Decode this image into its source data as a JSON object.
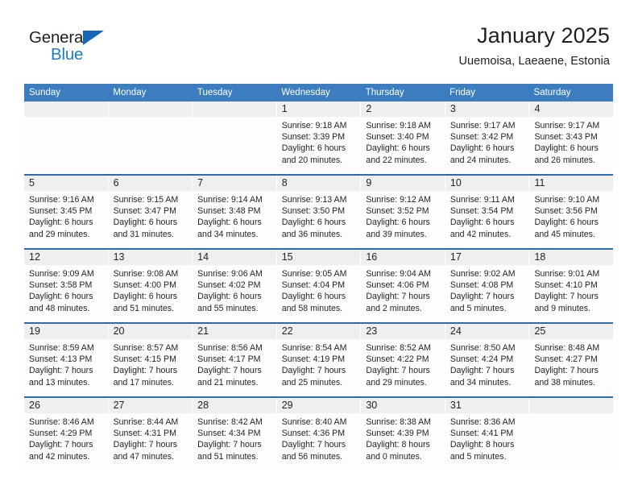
{
  "brand": {
    "logo_text_top": "General",
    "logo_text_bottom": "Blue",
    "logo_triangle_icon": "triangle-icon",
    "color_dark": "#231f20",
    "color_blue": "#1d7ec4"
  },
  "header": {
    "title": "January 2025",
    "subtitle": "Uuemoisa, Laeaene, Estonia"
  },
  "theme": {
    "header_row_bg": "#3b7dbf",
    "week_divider": "#2b6caf",
    "daynum_bg": "#efefef",
    "cell_bg": "#fdfdfd",
    "text": "#231f20"
  },
  "calendar": {
    "day_headers": [
      "Sunday",
      "Monday",
      "Tuesday",
      "Wednesday",
      "Thursday",
      "Friday",
      "Saturday"
    ],
    "weeks": [
      [
        {
          "day": "",
          "lines": []
        },
        {
          "day": "",
          "lines": []
        },
        {
          "day": "",
          "lines": []
        },
        {
          "day": "1",
          "lines": [
            "Sunrise: 9:18 AM",
            "Sunset: 3:39 PM",
            "Daylight: 6 hours",
            "and 20 minutes."
          ]
        },
        {
          "day": "2",
          "lines": [
            "Sunrise: 9:18 AM",
            "Sunset: 3:40 PM",
            "Daylight: 6 hours",
            "and 22 minutes."
          ]
        },
        {
          "day": "3",
          "lines": [
            "Sunrise: 9:17 AM",
            "Sunset: 3:42 PM",
            "Daylight: 6 hours",
            "and 24 minutes."
          ]
        },
        {
          "day": "4",
          "lines": [
            "Sunrise: 9:17 AM",
            "Sunset: 3:43 PM",
            "Daylight: 6 hours",
            "and 26 minutes."
          ]
        }
      ],
      [
        {
          "day": "5",
          "lines": [
            "Sunrise: 9:16 AM",
            "Sunset: 3:45 PM",
            "Daylight: 6 hours",
            "and 29 minutes."
          ]
        },
        {
          "day": "6",
          "lines": [
            "Sunrise: 9:15 AM",
            "Sunset: 3:47 PM",
            "Daylight: 6 hours",
            "and 31 minutes."
          ]
        },
        {
          "day": "7",
          "lines": [
            "Sunrise: 9:14 AM",
            "Sunset: 3:48 PM",
            "Daylight: 6 hours",
            "and 34 minutes."
          ]
        },
        {
          "day": "8",
          "lines": [
            "Sunrise: 9:13 AM",
            "Sunset: 3:50 PM",
            "Daylight: 6 hours",
            "and 36 minutes."
          ]
        },
        {
          "day": "9",
          "lines": [
            "Sunrise: 9:12 AM",
            "Sunset: 3:52 PM",
            "Daylight: 6 hours",
            "and 39 minutes."
          ]
        },
        {
          "day": "10",
          "lines": [
            "Sunrise: 9:11 AM",
            "Sunset: 3:54 PM",
            "Daylight: 6 hours",
            "and 42 minutes."
          ]
        },
        {
          "day": "11",
          "lines": [
            "Sunrise: 9:10 AM",
            "Sunset: 3:56 PM",
            "Daylight: 6 hours",
            "and 45 minutes."
          ]
        }
      ],
      [
        {
          "day": "12",
          "lines": [
            "Sunrise: 9:09 AM",
            "Sunset: 3:58 PM",
            "Daylight: 6 hours",
            "and 48 minutes."
          ]
        },
        {
          "day": "13",
          "lines": [
            "Sunrise: 9:08 AM",
            "Sunset: 4:00 PM",
            "Daylight: 6 hours",
            "and 51 minutes."
          ]
        },
        {
          "day": "14",
          "lines": [
            "Sunrise: 9:06 AM",
            "Sunset: 4:02 PM",
            "Daylight: 6 hours",
            "and 55 minutes."
          ]
        },
        {
          "day": "15",
          "lines": [
            "Sunrise: 9:05 AM",
            "Sunset: 4:04 PM",
            "Daylight: 6 hours",
            "and 58 minutes."
          ]
        },
        {
          "day": "16",
          "lines": [
            "Sunrise: 9:04 AM",
            "Sunset: 4:06 PM",
            "Daylight: 7 hours",
            "and 2 minutes."
          ]
        },
        {
          "day": "17",
          "lines": [
            "Sunrise: 9:02 AM",
            "Sunset: 4:08 PM",
            "Daylight: 7 hours",
            "and 5 minutes."
          ]
        },
        {
          "day": "18",
          "lines": [
            "Sunrise: 9:01 AM",
            "Sunset: 4:10 PM",
            "Daylight: 7 hours",
            "and 9 minutes."
          ]
        }
      ],
      [
        {
          "day": "19",
          "lines": [
            "Sunrise: 8:59 AM",
            "Sunset: 4:13 PM",
            "Daylight: 7 hours",
            "and 13 minutes."
          ]
        },
        {
          "day": "20",
          "lines": [
            "Sunrise: 8:57 AM",
            "Sunset: 4:15 PM",
            "Daylight: 7 hours",
            "and 17 minutes."
          ]
        },
        {
          "day": "21",
          "lines": [
            "Sunrise: 8:56 AM",
            "Sunset: 4:17 PM",
            "Daylight: 7 hours",
            "and 21 minutes."
          ]
        },
        {
          "day": "22",
          "lines": [
            "Sunrise: 8:54 AM",
            "Sunset: 4:19 PM",
            "Daylight: 7 hours",
            "and 25 minutes."
          ]
        },
        {
          "day": "23",
          "lines": [
            "Sunrise: 8:52 AM",
            "Sunset: 4:22 PM",
            "Daylight: 7 hours",
            "and 29 minutes."
          ]
        },
        {
          "day": "24",
          "lines": [
            "Sunrise: 8:50 AM",
            "Sunset: 4:24 PM",
            "Daylight: 7 hours",
            "and 34 minutes."
          ]
        },
        {
          "day": "25",
          "lines": [
            "Sunrise: 8:48 AM",
            "Sunset: 4:27 PM",
            "Daylight: 7 hours",
            "and 38 minutes."
          ]
        }
      ],
      [
        {
          "day": "26",
          "lines": [
            "Sunrise: 8:46 AM",
            "Sunset: 4:29 PM",
            "Daylight: 7 hours",
            "and 42 minutes."
          ]
        },
        {
          "day": "27",
          "lines": [
            "Sunrise: 8:44 AM",
            "Sunset: 4:31 PM",
            "Daylight: 7 hours",
            "and 47 minutes."
          ]
        },
        {
          "day": "28",
          "lines": [
            "Sunrise: 8:42 AM",
            "Sunset: 4:34 PM",
            "Daylight: 7 hours",
            "and 51 minutes."
          ]
        },
        {
          "day": "29",
          "lines": [
            "Sunrise: 8:40 AM",
            "Sunset: 4:36 PM",
            "Daylight: 7 hours",
            "and 56 minutes."
          ]
        },
        {
          "day": "30",
          "lines": [
            "Sunrise: 8:38 AM",
            "Sunset: 4:39 PM",
            "Daylight: 8 hours",
            "and 0 minutes."
          ]
        },
        {
          "day": "31",
          "lines": [
            "Sunrise: 8:36 AM",
            "Sunset: 4:41 PM",
            "Daylight: 8 hours",
            "and 5 minutes."
          ]
        },
        {
          "day": "",
          "lines": []
        }
      ]
    ]
  }
}
